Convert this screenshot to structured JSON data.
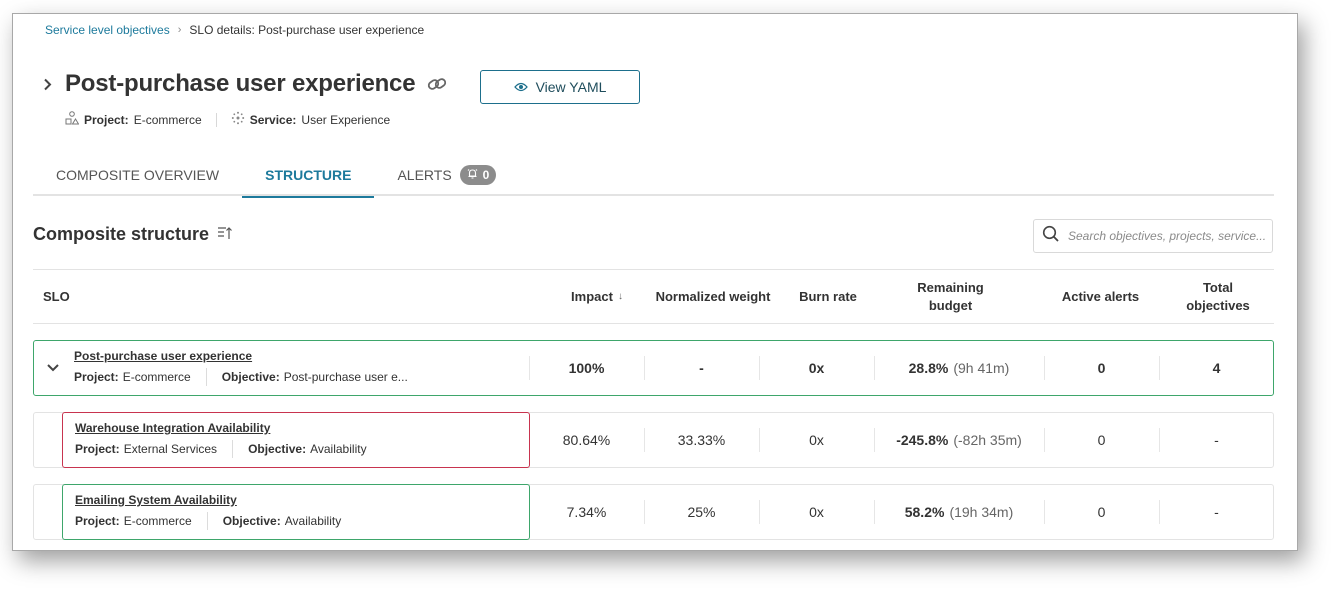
{
  "breadcrumb": {
    "items": [
      {
        "label": "Service level objectives",
        "link": true
      },
      {
        "label": "SLO details: Post-purchase user experience",
        "link": false
      }
    ],
    "separator": "›"
  },
  "header": {
    "title": "Post-purchase user experience",
    "view_yaml_label": "View YAML",
    "project_label": "Project:",
    "project_value": "E-commerce",
    "service_label": "Service:",
    "service_value": "User Experience"
  },
  "tabs": [
    {
      "label": "COMPOSITE OVERVIEW",
      "active": false
    },
    {
      "label": "STRUCTURE",
      "active": true
    },
    {
      "label": "ALERTS",
      "active": false,
      "badge": "0"
    }
  ],
  "structure": {
    "title": "Composite structure",
    "search_placeholder": "Search objectives, projects, service..."
  },
  "table": {
    "columns": [
      {
        "key": "slo",
        "label": "SLO"
      },
      {
        "key": "impact",
        "label": "Impact",
        "sort": "desc"
      },
      {
        "key": "normalized_weight",
        "label": "Normalized weight"
      },
      {
        "key": "burn_rate",
        "label": "Burn rate"
      },
      {
        "key": "remaining_budget",
        "label": "Remaining budget"
      },
      {
        "key": "active_alerts",
        "label": "Active alerts"
      },
      {
        "key": "total_objectives",
        "label": "Total objectives"
      }
    ],
    "sort_arrow": "↓",
    "rows": [
      {
        "name": "Post-purchase user experience",
        "project_label": "Project:",
        "project": "E-commerce",
        "objective_label": "Objective:",
        "objective": "Post-purchase user e...",
        "impact": "100%",
        "normalized_weight": "-",
        "burn_rate": "0x",
        "remaining_budget": "28.8%",
        "remaining_time": "(9h 41m)",
        "active_alerts": "0",
        "total_objectives": "4",
        "status": "ok",
        "expanded": true,
        "level": 0
      },
      {
        "name": "Warehouse Integration Availability",
        "project_label": "Project:",
        "project": "External Services",
        "objective_label": "Objective:",
        "objective": "Availability",
        "impact": "80.64%",
        "normalized_weight": "33.33%",
        "burn_rate": "0x",
        "remaining_budget": "-245.8%",
        "remaining_time": "(-82h 35m)",
        "active_alerts": "0",
        "total_objectives": "-",
        "status": "exhausted",
        "level": 1
      },
      {
        "name": "Emailing System Availability",
        "project_label": "Project:",
        "project": "E-commerce",
        "objective_label": "Objective:",
        "objective": "Availability",
        "impact": "7.34%",
        "normalized_weight": "25%",
        "burn_rate": "0x",
        "remaining_budget": "58.2%",
        "remaining_time": "(19h 34m)",
        "active_alerts": "0",
        "total_objectives": "-",
        "status": "ok",
        "level": 1
      }
    ]
  },
  "colors": {
    "accent": "#1d7a9c",
    "status_ok": "#3ea66b",
    "status_exhausted": "#c8344f",
    "badge_bg": "#8c8c8c"
  }
}
